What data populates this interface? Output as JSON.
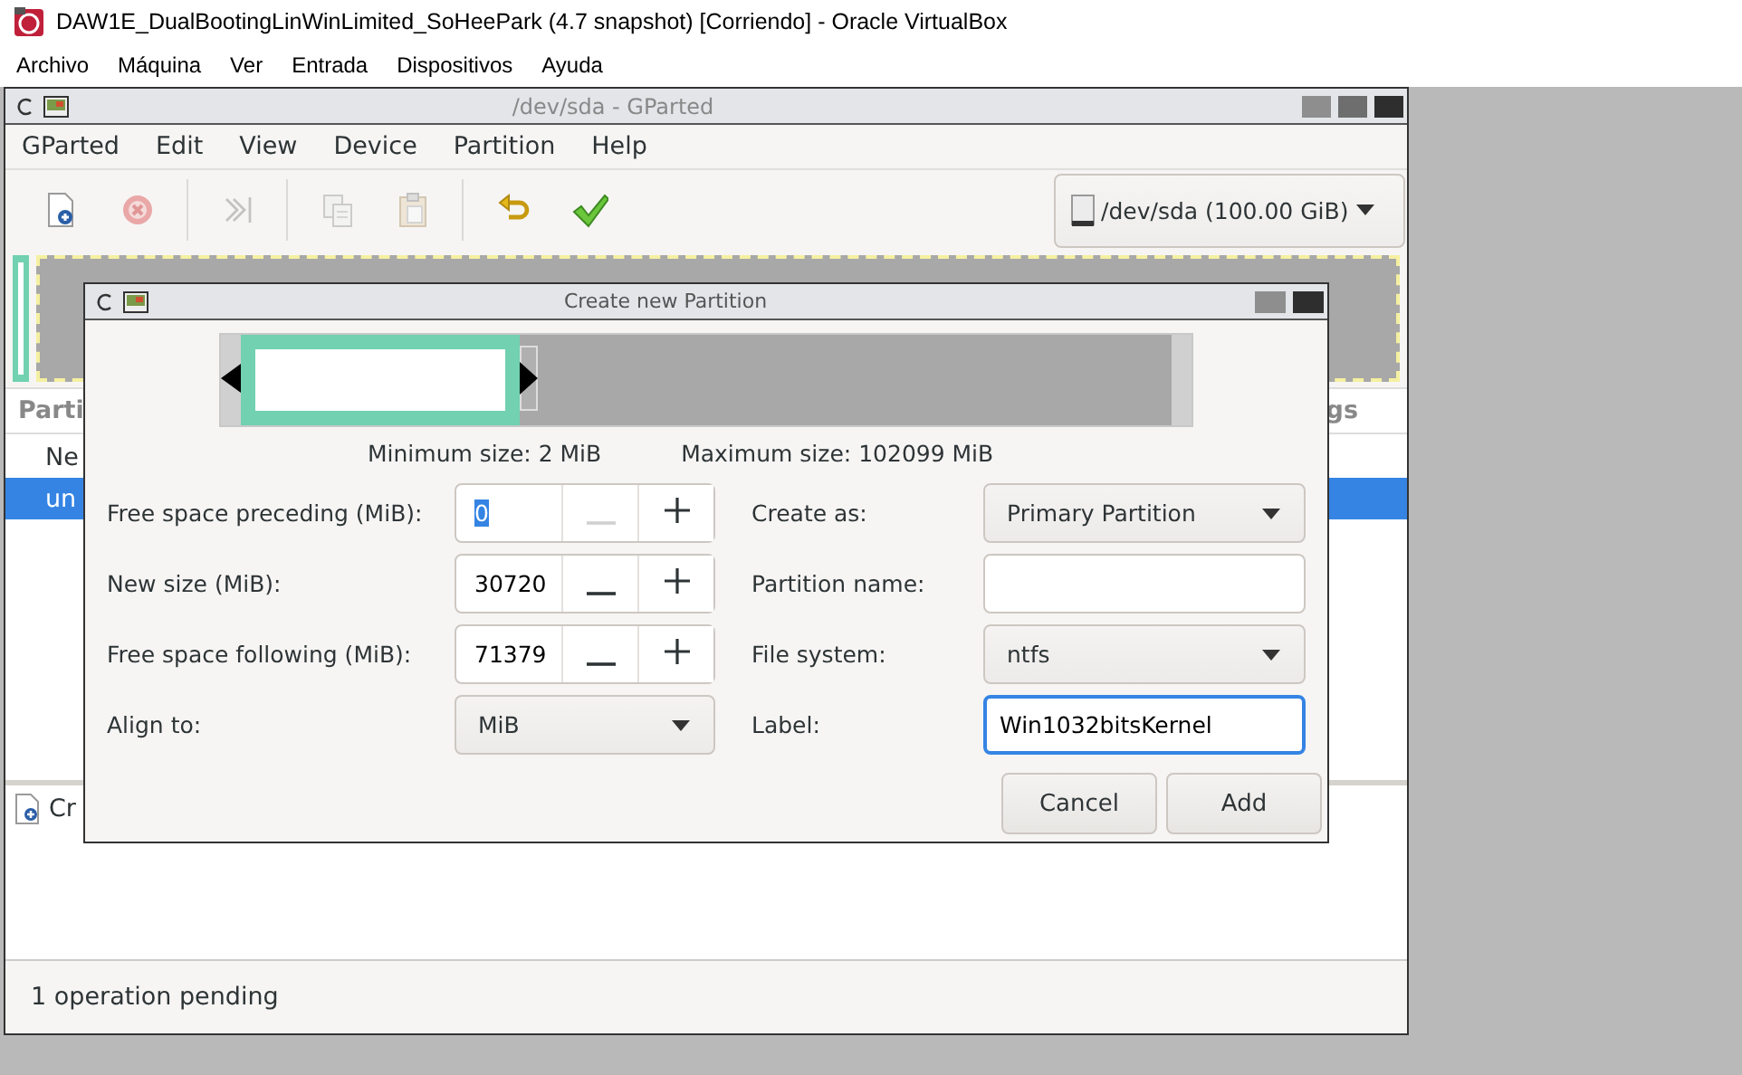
{
  "host": {
    "title": "DAW1E_DualBootingLinWinLimited_SoHeePark (4.7 snapshot) [Corriendo] - Oracle VirtualBox",
    "menu": [
      "Archivo",
      "Máquina",
      "Ver",
      "Entrada",
      "Dispositivos",
      "Ayuda"
    ]
  },
  "gparted": {
    "title": "/dev/sda - GParted",
    "menu": [
      "GParted",
      "Edit",
      "View",
      "Device",
      "Partition",
      "Help"
    ],
    "toolbar": [
      {
        "kind": "new",
        "disabled": false
      },
      {
        "kind": "delete",
        "disabled": true
      },
      {
        "kind": "resize",
        "disabled": true
      },
      {
        "kind": "copy",
        "disabled": true
      },
      {
        "kind": "paste",
        "disabled": true
      },
      {
        "kind": "undo",
        "disabled": false
      },
      {
        "kind": "apply",
        "disabled": false
      }
    ],
    "device": "/dev/sda (100.00 GiB)",
    "disk_map": [
      {
        "kind": "new",
        "selected": false
      },
      {
        "kind": "unallocated",
        "selected": true
      }
    ],
    "table": {
      "columns": [
        "Parti",
        "gs"
      ],
      "rows": [
        {
          "cells": [
            "Ne"
          ],
          "selected": false
        },
        {
          "cells": [
            "un"
          ],
          "selected": true
        }
      ]
    },
    "operations": [
      "Cr"
    ],
    "status": "1 operation pending"
  },
  "dialog": {
    "title": "Create new Partition",
    "size_bar": {
      "level": 0.3
    },
    "min_size": "Minimum size: 2 MiB",
    "max_size": "Maximum size: 102099 MiB",
    "left_fields": [
      {
        "kind": "spin",
        "label": "Free space preceding (MiB):",
        "value": "0",
        "text_selected": true,
        "minus_disabled": true
      },
      {
        "kind": "spin",
        "label": "New size (MiB):",
        "value": "30720",
        "text_selected": false,
        "minus_disabled": false
      },
      {
        "kind": "spin",
        "label": "Free space following (MiB):",
        "value": "71379",
        "text_selected": false,
        "minus_disabled": false
      },
      {
        "kind": "combo",
        "label": "Align to:",
        "value": "MiB"
      }
    ],
    "right_fields": [
      {
        "kind": "combo",
        "label": "Create as:",
        "value": "Primary Partition"
      },
      {
        "kind": "entry",
        "label": "Partition name:",
        "focused": false
      },
      {
        "kind": "combo",
        "label": "File system:",
        "value": "ntfs"
      },
      {
        "kind": "entry",
        "label": "Label:",
        "value": "Win1032bitsKernel",
        "focused": true
      }
    ],
    "buttons": [
      "Cancel",
      "Add"
    ]
  }
}
